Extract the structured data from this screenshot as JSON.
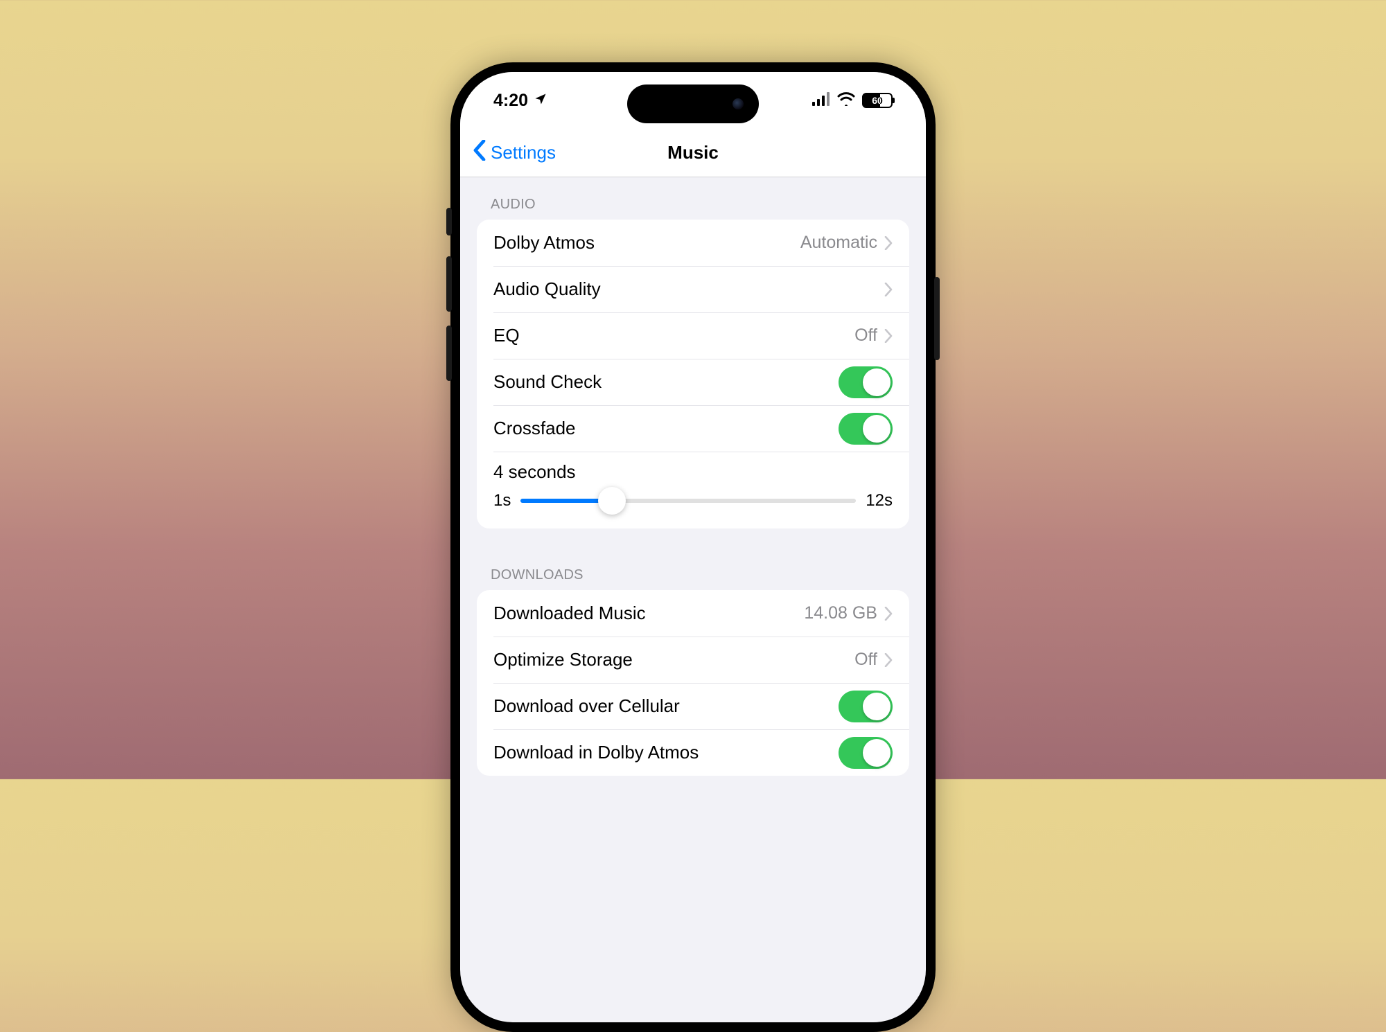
{
  "status": {
    "time": "4:20",
    "battery_text": "60",
    "battery_pct": 60
  },
  "nav": {
    "back_label": "Settings",
    "title": "Music"
  },
  "sections": {
    "audio": {
      "header": "AUDIO",
      "dolby_atmos": {
        "label": "Dolby Atmos",
        "value": "Automatic"
      },
      "audio_quality": {
        "label": "Audio Quality",
        "value": ""
      },
      "eq": {
        "label": "EQ",
        "value": "Off"
      },
      "sound_check": {
        "label": "Sound Check",
        "on": true
      },
      "crossfade": {
        "label": "Crossfade",
        "on": true
      },
      "crossfade_slider": {
        "title": "4 seconds",
        "min_label": "1s",
        "max_label": "12s",
        "min": 1,
        "max": 12,
        "value": 4
      }
    },
    "downloads": {
      "header": "DOWNLOADS",
      "downloaded_music": {
        "label": "Downloaded Music",
        "value": "14.08 GB"
      },
      "optimize_storage": {
        "label": "Optimize Storage",
        "value": "Off"
      },
      "download_cellular": {
        "label": "Download over Cellular",
        "on": true
      },
      "download_dolby": {
        "label": "Download in Dolby Atmos",
        "on": true
      }
    }
  }
}
